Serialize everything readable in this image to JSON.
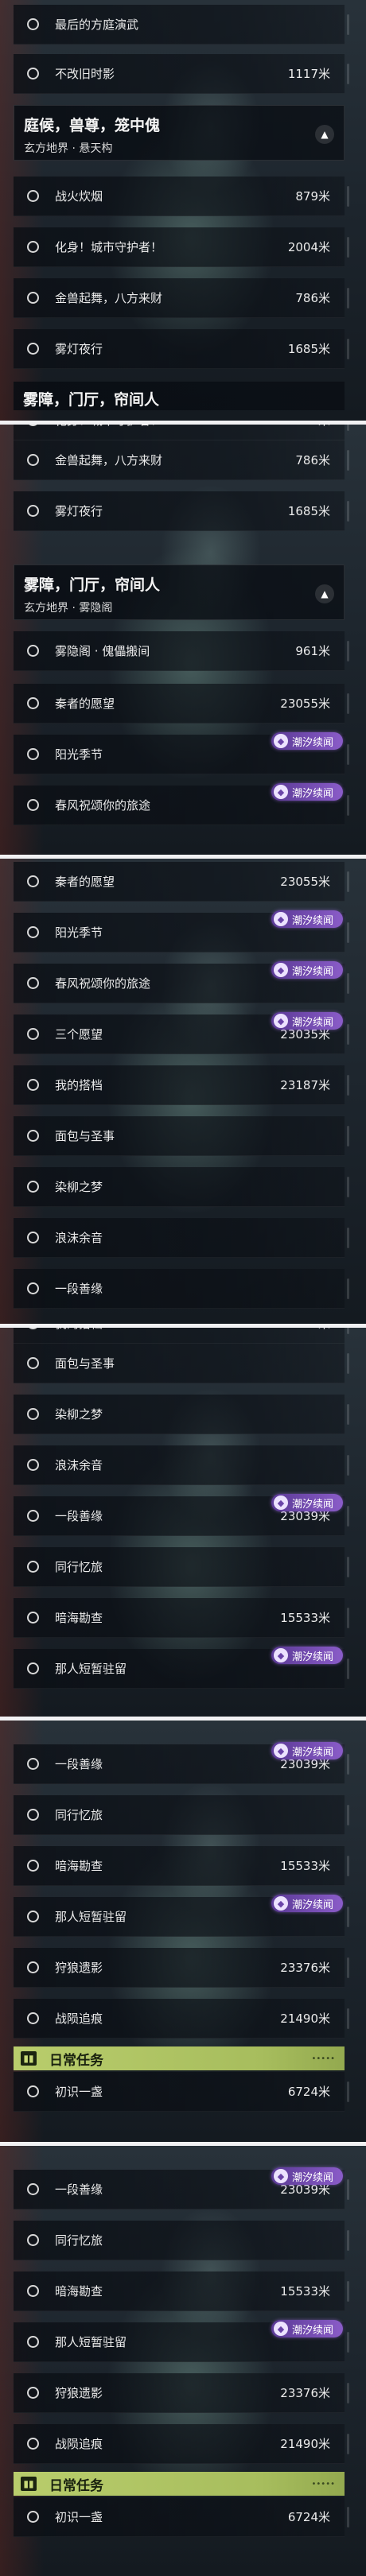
{
  "badge_text": "潮汐续闻",
  "headers": {
    "courtyard": {
      "title": "庭候，兽尊，笼中傀",
      "subtitle": "玄方地界 · 悬天构"
    },
    "fog": {
      "title": "雾障，门厅，帘间人",
      "subtitle": "玄方地界 · 雾隐阁"
    },
    "daily": "日常任务"
  },
  "tasks": {
    "last_square": {
      "label": "最后的方庭演武",
      "distance": ""
    },
    "old_shadow": {
      "label": "不改旧时影",
      "distance": "1117米"
    },
    "war_fire": {
      "label": "战火炊烟",
      "distance": "879米"
    },
    "guardian": {
      "label": "化身！城市守护者！",
      "distance": "2004米"
    },
    "lion": {
      "label": "金兽起舞，八方来财",
      "distance": "786米"
    },
    "fog_lamp": {
      "label": "雾灯夜行",
      "distance": "1685米"
    },
    "puppet": {
      "label": "雾隐阁 · 傀儡搬间",
      "distance": "961米"
    },
    "qin_wish": {
      "label": "秦者的愿望",
      "distance": "23055米"
    },
    "sun_festival": {
      "label": "阳光季节",
      "distance": ""
    },
    "spring_trip": {
      "label": "春风祝颂你的旅途",
      "distance": ""
    },
    "three_wishes": {
      "label": "三个愿望",
      "distance": "23035米"
    },
    "my_partner": {
      "label": "我的搭档",
      "distance": "23187米"
    },
    "bread": {
      "label": "面包与圣事",
      "distance": ""
    },
    "willow_dream": {
      "label": "染柳之梦",
      "distance": ""
    },
    "foam": {
      "label": "浪沫余音",
      "distance": ""
    },
    "good_fate": {
      "label": "一段善缘",
      "distance": "23039米"
    },
    "travel_memory": {
      "label": "同行忆旅",
      "distance": ""
    },
    "sea_survey": {
      "label": "暗海勘查",
      "distance": "15533米"
    },
    "short_stay": {
      "label": "那人短暂驻留",
      "distance": ""
    },
    "wolf_trace": {
      "label": "狩狼遗影",
      "distance": "23376米"
    },
    "battle_trace": {
      "label": "战陨追痕",
      "distance": "21490米"
    },
    "first_cup": {
      "label": "初识一盏",
      "distance": "6724米"
    }
  }
}
